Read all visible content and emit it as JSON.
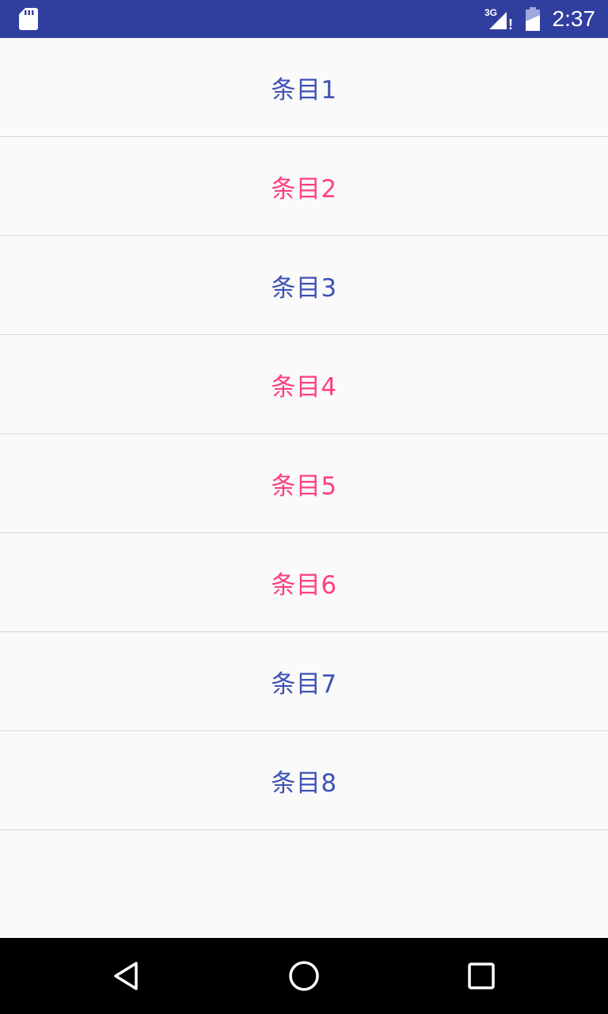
{
  "status_bar": {
    "network_label": "3G",
    "alert_mark": "!",
    "time": "2:37",
    "background": "#303f9f",
    "icons": [
      "sd-card-icon",
      "signal-icon",
      "battery-icon"
    ]
  },
  "list": {
    "items": [
      {
        "label": "条目1",
        "color": "#3f51b5"
      },
      {
        "label": "条目2",
        "color": "#ff4081"
      },
      {
        "label": "条目3",
        "color": "#3f51b5"
      },
      {
        "label": "条目4",
        "color": "#ff4081"
      },
      {
        "label": "条目5",
        "color": "#ff4081"
      },
      {
        "label": "条目6",
        "color": "#ff4081"
      },
      {
        "label": "条目7",
        "color": "#3f51b5"
      },
      {
        "label": "条目8",
        "color": "#3f51b5"
      }
    ]
  },
  "nav_bar": {
    "icons": [
      "back-icon",
      "home-icon",
      "recents-icon"
    ]
  }
}
